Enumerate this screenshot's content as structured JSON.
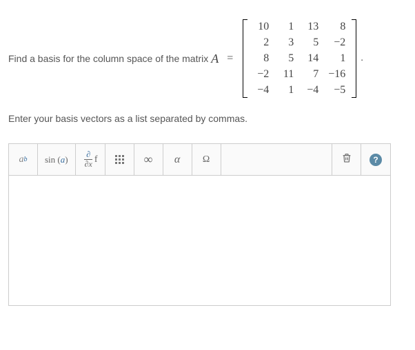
{
  "problem": {
    "prompt_prefix": "Find a basis for the column space of the matrix ",
    "matrix_var": "A",
    "equals": "=",
    "period": "."
  },
  "matrix": {
    "rows": [
      [
        "10",
        "1",
        "13",
        "8"
      ],
      [
        "2",
        "3",
        "5",
        "−2"
      ],
      [
        "8",
        "5",
        "14",
        "1"
      ],
      [
        "−2",
        "11",
        "7",
        "−16"
      ],
      [
        "−4",
        "1",
        "−4",
        "−5"
      ]
    ]
  },
  "instruction": "Enter your basis vectors as a list separated by commas.",
  "toolbar": {
    "exponent": {
      "base": "a",
      "sup": "b"
    },
    "trig": {
      "fn": "sin",
      "open": "(",
      "arg": "a",
      "close": ")"
    },
    "deriv": {
      "top": "∂",
      "bot": "∂x",
      "side": "f"
    },
    "infinity": "∞",
    "alpha": "α",
    "omega": "Ω",
    "help": "?"
  },
  "chart_data": {
    "type": "table",
    "title": "Matrix A",
    "rows": 5,
    "cols": 4,
    "values": [
      [
        10,
        1,
        13,
        8
      ],
      [
        2,
        3,
        5,
        -2
      ],
      [
        8,
        5,
        14,
        1
      ],
      [
        -2,
        11,
        7,
        -16
      ],
      [
        -4,
        1,
        -4,
        -5
      ]
    ]
  }
}
